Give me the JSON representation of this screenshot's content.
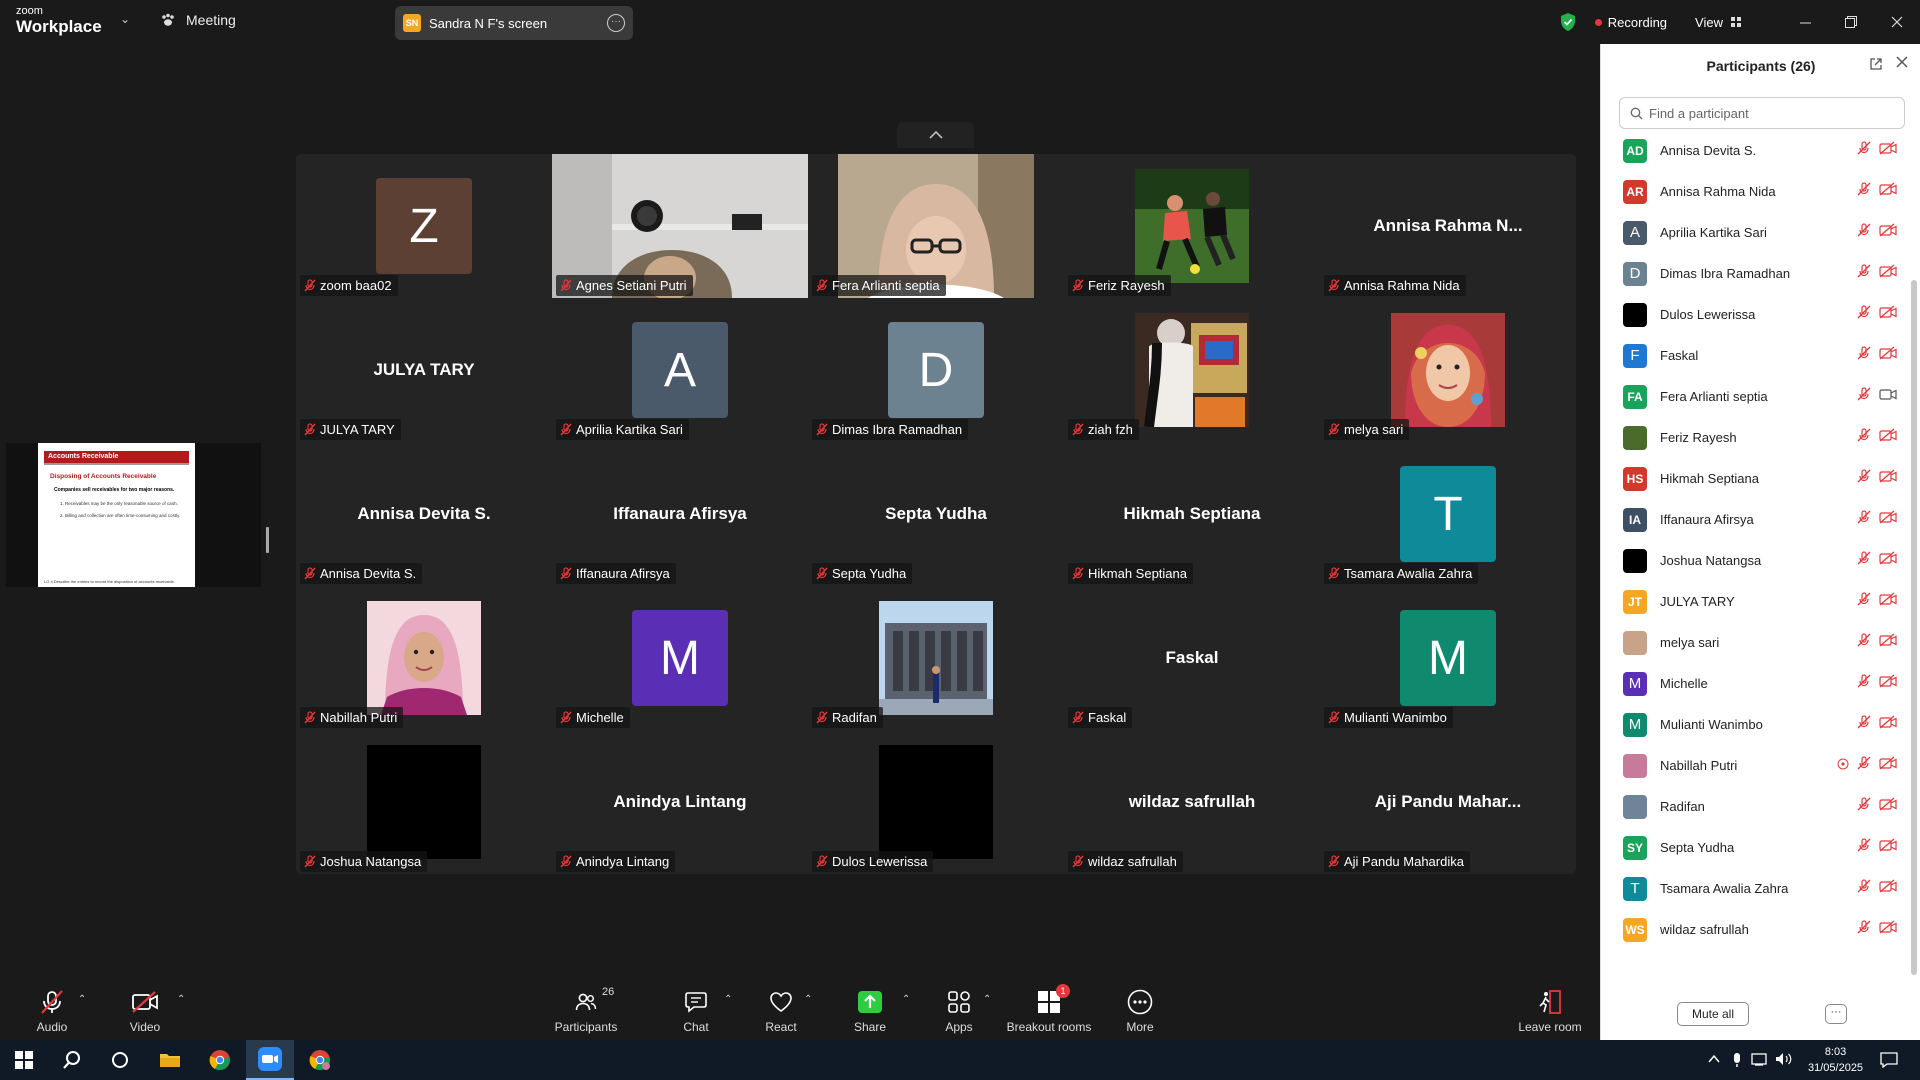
{
  "topbar": {
    "brand_small": "zoom",
    "brand_big": "Workplace",
    "meeting_label": "Meeting",
    "share_badge": "SN",
    "share_title": "Sandra N F's screen",
    "recording_label": "Recording",
    "view_label": "View"
  },
  "slide": {
    "title": "Accounts Receivable",
    "subtitle": "Disposing of Accounts Receivable",
    "line1": "Companies sell receivables for two major reasons.",
    "line2": "1. Receivables may be the only reasonable source of cash.",
    "line3": "2. Billing and collection are often time-consuming and costly.",
    "footer": "LO 4 Describe the entries to record the disposition of accounts receivable."
  },
  "tiles": [
    {
      "name": "zoom baa02",
      "kind": "avatar",
      "letter": "Z",
      "color": "#5c4033"
    },
    {
      "name": "Agnes Setiani Putri",
      "kind": "video",
      "theme": "room"
    },
    {
      "name": "Fera Arlianti septia",
      "kind": "video",
      "theme": "person"
    },
    {
      "name": "Feriz Rayesh",
      "kind": "photo",
      "theme": "soccer"
    },
    {
      "name": "Annisa Rahma Nida",
      "kind": "text",
      "display": "Annisa Rahma N..."
    },
    {
      "name": "JULYA TARY",
      "kind": "text",
      "display": "JULYA TARY"
    },
    {
      "name": "Aprilia Kartika Sari",
      "kind": "avatar",
      "letter": "A",
      "color": "#4a5a6a"
    },
    {
      "name": "Dimas Ibra Ramadhan",
      "kind": "avatar",
      "letter": "D",
      "color": "#6d8290"
    },
    {
      "name": "ziah fzh",
      "kind": "photo",
      "theme": "arcade"
    },
    {
      "name": "melya sari",
      "kind": "photo",
      "theme": "hijab-red"
    },
    {
      "name": "Annisa Devita S.",
      "kind": "text",
      "display": "Annisa Devita S."
    },
    {
      "name": "Iffanaura Afirsya",
      "kind": "text",
      "display": "Iffanaura Afirsya"
    },
    {
      "name": "Septa Yudha",
      "kind": "text",
      "display": "Septa Yudha"
    },
    {
      "name": "Hikmah Septiana",
      "kind": "text",
      "display": "Hikmah Septiana"
    },
    {
      "name": "Tsamara Awalia Zahra",
      "kind": "avatar",
      "letter": "T",
      "color": "#0e8a99"
    },
    {
      "name": "Nabillah Putri",
      "kind": "photo",
      "theme": "hijab-pink"
    },
    {
      "name": "Michelle",
      "kind": "avatar",
      "letter": "M",
      "color": "#5b2fb5"
    },
    {
      "name": "Radifan",
      "kind": "photo",
      "theme": "building"
    },
    {
      "name": "Faskal",
      "kind": "text",
      "display": "Faskal"
    },
    {
      "name": "Mulianti Wanimbo",
      "kind": "avatar",
      "letter": "M",
      "color": "#0f8a6e"
    },
    {
      "name": "Joshua Natangsa",
      "kind": "photo",
      "theme": "black"
    },
    {
      "name": "Anindya Lintang",
      "kind": "text",
      "display": "Anindya Lintang"
    },
    {
      "name": "Dulos Lewerissa",
      "kind": "photo",
      "theme": "black"
    },
    {
      "name": "wildaz safrullah",
      "kind": "text",
      "display": "wildaz safrullah"
    },
    {
      "name": "Aji Pandu Mahardika",
      "kind": "text",
      "display": "Aji Pandu Mahar..."
    }
  ],
  "panel": {
    "title": "Participants (26)",
    "search_placeholder": "Find a participant",
    "mute_all_label": "Mute all",
    "participants": [
      {
        "initials": "AD",
        "name": "Annisa Devita S.",
        "color": "#1aa35a",
        "video_on": false
      },
      {
        "initials": "AR",
        "name": "Annisa Rahma Nida",
        "color": "#d0392b",
        "video_on": false
      },
      {
        "initials": "A",
        "name": "Aprilia Kartika Sari",
        "color": "#4a5a6a",
        "video_on": false
      },
      {
        "initials": "D",
        "name": "Dimas Ibra Ramadhan",
        "color": "#6d8290",
        "video_on": false
      },
      {
        "initials": "",
        "name": "Dulos Lewerissa",
        "color": "#000000",
        "video_on": false
      },
      {
        "initials": "F",
        "name": "Faskal",
        "color": "#1f78d1",
        "video_on": false
      },
      {
        "initials": "FA",
        "name": "Fera Arlianti septia",
        "color": "#1aa35a",
        "video_on": true
      },
      {
        "initials": "",
        "name": "Feriz Rayesh",
        "color": "#4a6b2a",
        "video_on": false
      },
      {
        "initials": "HS",
        "name": "Hikmah Septiana",
        "color": "#d0392b",
        "video_on": false
      },
      {
        "initials": "IA",
        "name": "Iffanaura Afirsya",
        "color": "#3d4f63",
        "video_on": false
      },
      {
        "initials": "",
        "name": "Joshua Natangsa",
        "color": "#000000",
        "video_on": false
      },
      {
        "initials": "JT",
        "name": "JULYA TARY",
        "color": "#f5a623",
        "video_on": false
      },
      {
        "initials": "",
        "name": "melya sari",
        "color": "#c9a28a",
        "video_on": false
      },
      {
        "initials": "M",
        "name": "Michelle",
        "color": "#5b2fb5",
        "video_on": false
      },
      {
        "initials": "M",
        "name": "Mulianti Wanimbo",
        "color": "#0f8a6e",
        "video_on": false
      },
      {
        "initials": "",
        "name": "Nabillah Putri",
        "color": "#c77a9a",
        "video_on": false,
        "raised": true
      },
      {
        "initials": "",
        "name": "Radifan",
        "color": "#6f8399",
        "video_on": false
      },
      {
        "initials": "SY",
        "name": "Septa Yudha",
        "color": "#1aa35a",
        "video_on": false
      },
      {
        "initials": "T",
        "name": "Tsamara Awalia Zahra",
        "color": "#0e8a99",
        "video_on": false
      },
      {
        "initials": "WS",
        "name": "wildaz safrullah",
        "color": "#f5a623",
        "video_on": false
      },
      {
        "initials": "",
        "name": "ziah fzh",
        "color": "#8a6a55",
        "video_on": false
      }
    ]
  },
  "toolbar": {
    "audio_label": "Audio",
    "video_label": "Video",
    "participants_label": "Participants",
    "participants_count": "26",
    "chat_label": "Chat",
    "react_label": "React",
    "share_label": "Share",
    "apps_label": "Apps",
    "breakout_label": "Breakout rooms",
    "breakout_badge": "1",
    "more_label": "More",
    "leave_label": "Leave room"
  },
  "taskbar": {
    "time": "8:03",
    "date": "31/05/2025"
  },
  "colors": {
    "accent_green": "#2ecc40",
    "mic_off_red": "#e5383b",
    "panel_bg": "#ffffff"
  }
}
